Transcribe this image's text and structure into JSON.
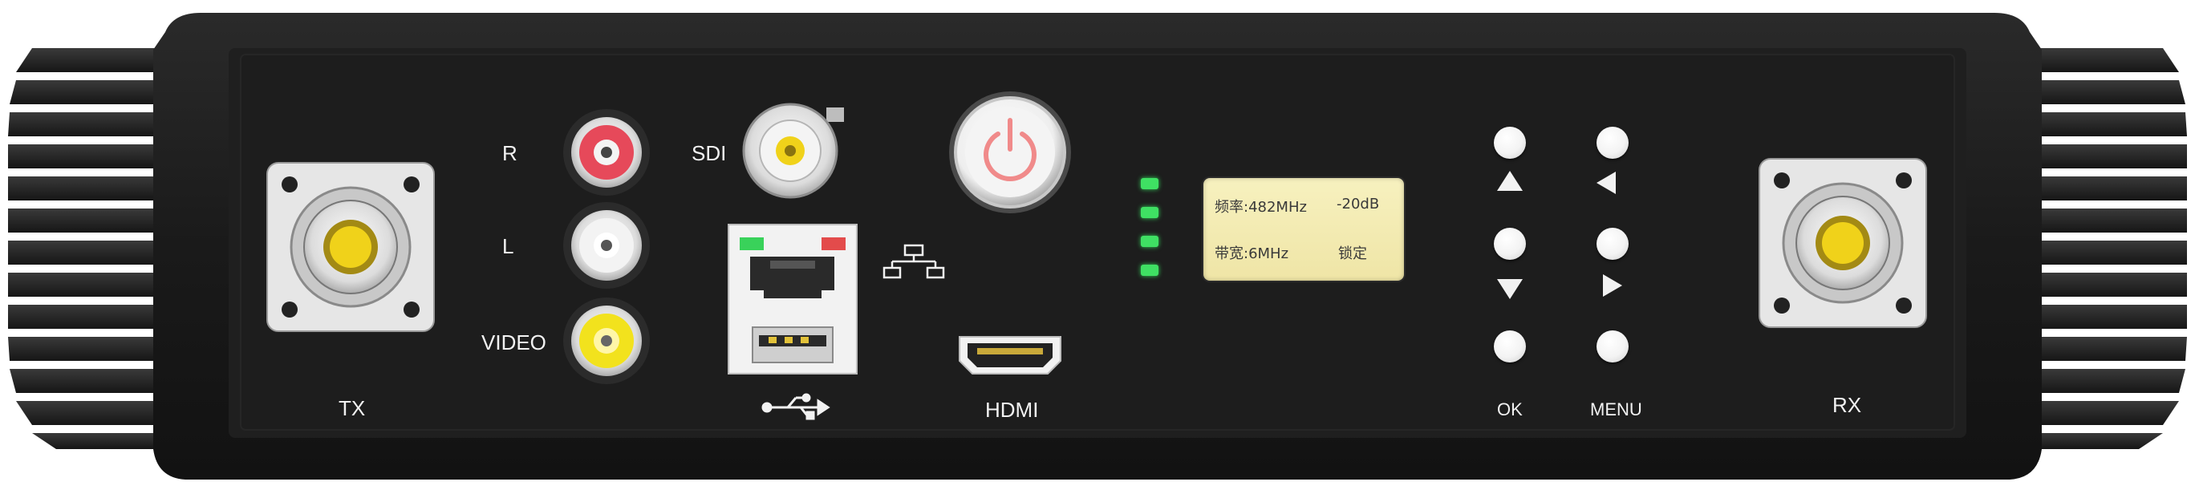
{
  "ports": {
    "tx_label": "TX",
    "rx_label": "RX",
    "audio_right_label": "R",
    "audio_left_label": "L",
    "video_label": "VIDEO",
    "sdi_label": "SDI",
    "hdmi_label": "HDMI"
  },
  "display": {
    "frequency_text": "频率:482MHz",
    "level_text": "-20dB",
    "bandwidth_text": "带宽:6MHz",
    "lock_text": "锁定"
  },
  "buttons": {
    "ok_label": "OK",
    "menu_label": "MENU"
  },
  "status_leds": {
    "count": 4,
    "color": "#3fe063"
  },
  "colors": {
    "chassis": "#1c1c1c",
    "rca_red": "#e6495a",
    "rca_yellow": "#f2e21d",
    "power_icon": "#f08a8a"
  }
}
